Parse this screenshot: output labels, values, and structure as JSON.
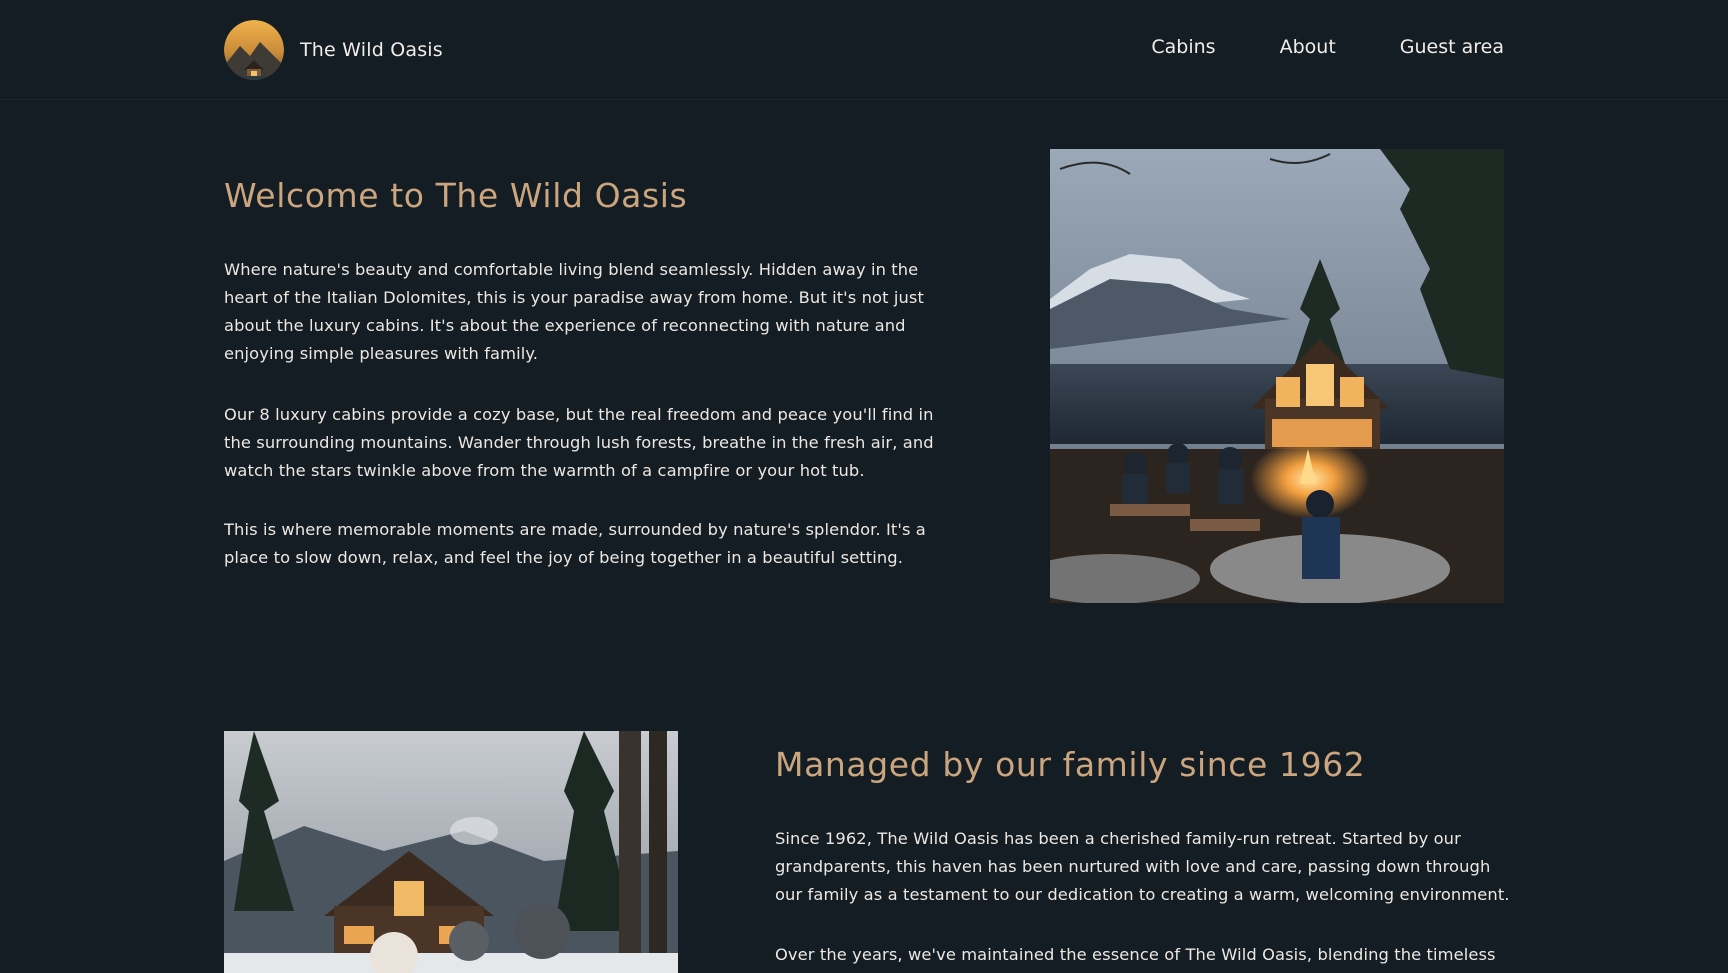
{
  "header": {
    "logo_icon": "mountain-cabin-logo",
    "brand": "The Wild Oasis",
    "nav": [
      {
        "label": "Cabins"
      },
      {
        "label": "About"
      },
      {
        "label": "Guest area"
      }
    ]
  },
  "welcome": {
    "title": "Welcome to The Wild Oasis",
    "paragraphs": [
      "Where nature's beauty and comfortable living blend seamlessly. Hidden away in the heart of the Italian Dolomites, this is your paradise away from home. But it's not just about the luxury cabins. It's about the experience of reconnecting with nature and enjoying simple pleasures with family.",
      "Our 8 luxury cabins provide a cozy base, but the real freedom and peace you'll find in the surrounding mountains. Wander through lush forests, breathe in the fresh air, and watch the stars twinkle above from the warmth of a campfire or your hot tub.",
      "This is where memorable moments are made, surrounded by nature's splendor. It's a place to slow down, relax, and feel the joy of being together in a beautiful setting."
    ],
    "image_subject": "lakeside-cabin-campfire-photo"
  },
  "family": {
    "title": "Managed by our family since 1962",
    "paragraphs": [
      "Since 1962, The Wild Oasis has been a cherished family-run retreat. Started by our grandparents, this haven has been nurtured with love and care, passing down through our family as a testament to our dedication to creating a warm, welcoming environment.",
      "Over the years, we've maintained the essence of The Wild Oasis, blending the timeless"
    ],
    "image_subject": "family-in-front-of-cabin-photo"
  },
  "colors": {
    "background": "#141c24",
    "accent": "#caa57d",
    "text": "#ece8e2"
  }
}
